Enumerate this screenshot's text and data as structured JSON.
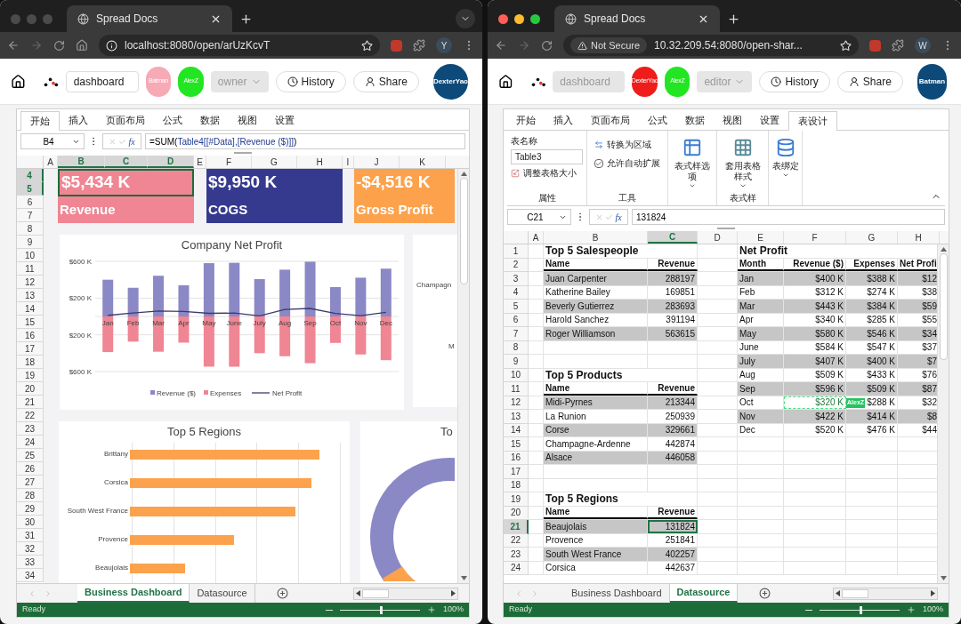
{
  "windows": [
    {
      "traffic_lights_active": false,
      "tab_title": "Spread Docs",
      "tab_search_button": true,
      "home_button": true,
      "address": {
        "not_secure": false,
        "url": "localhost:8080/open/arUzKcvT"
      },
      "profile": "Y",
      "header": {
        "doc_name": {
          "value": "dashboard",
          "disabled": false
        },
        "collaborators": [
          {
            "name": "Batman",
            "color": "#f7a9b6"
          },
          {
            "name": "AlexZ",
            "color": "#22e622"
          }
        ],
        "role": "owner",
        "history": "History",
        "share": "Share",
        "user": "DexterYao"
      },
      "ribbon": {
        "tabs": [
          {
            "label": "开始",
            "selected": true
          },
          {
            "label": "插入",
            "selected": false
          },
          {
            "label": "页面布局",
            "selected": false
          },
          {
            "label": "公式",
            "selected": false
          },
          {
            "label": "数据",
            "selected": false
          },
          {
            "label": "视图",
            "selected": false
          },
          {
            "label": "设置",
            "selected": false
          }
        ]
      },
      "formula_bar": {
        "cell": "B4",
        "fx_label": "fx",
        "formula": [
          {
            "text": "=SUM(",
            "kind": "plain"
          },
          {
            "text": "Table4[[#Data],[Revenue ($)]]",
            "kind": "reference"
          },
          {
            "text": ")",
            "kind": "plain"
          }
        ]
      },
      "columns": [
        {
          "label": "A",
          "selected": false
        },
        {
          "label": "B",
          "selected": true
        },
        {
          "label": "C",
          "selected": true
        },
        {
          "label": "D",
          "selected": true
        },
        {
          "label": "E",
          "selected": false
        },
        {
          "label": "F",
          "selected": false
        },
        {
          "label": "G",
          "selected": false
        },
        {
          "label": "H",
          "selected": false
        },
        {
          "label": "I",
          "selected": false
        },
        {
          "label": "J",
          "selected": false
        },
        {
          "label": "K",
          "selected": false
        }
      ],
      "rows": [
        {
          "label": "4",
          "selected": true
        },
        {
          "label": "5",
          "selected": true
        },
        {
          "label": "6",
          "selected": false
        },
        {
          "label": "7",
          "selected": false
        },
        {
          "label": "8",
          "selected": false
        },
        {
          "label": "9",
          "selected": false
        },
        {
          "label": "10",
          "selected": false
        },
        {
          "label": "11",
          "selected": false
        },
        {
          "label": "12",
          "selected": false
        },
        {
          "label": "13",
          "selected": false
        },
        {
          "label": "14",
          "selected": false
        },
        {
          "label": "15",
          "selected": false
        },
        {
          "label": "16",
          "selected": false
        },
        {
          "label": "17",
          "selected": false
        },
        {
          "label": "18",
          "selected": false
        },
        {
          "label": "19",
          "selected": false
        },
        {
          "label": "20",
          "selected": false
        },
        {
          "label": "21",
          "selected": false
        },
        {
          "label": "22",
          "selected": false
        },
        {
          "label": "23",
          "selected": false
        },
        {
          "label": "24",
          "selected": false
        },
        {
          "label": "25",
          "selected": false
        },
        {
          "label": "26",
          "selected": false
        },
        {
          "label": "27",
          "selected": false
        },
        {
          "label": "28",
          "selected": false
        },
        {
          "label": "29",
          "selected": false
        },
        {
          "label": "30",
          "selected": false
        },
        {
          "label": "31",
          "selected": false
        },
        {
          "label": "32",
          "selected": false
        },
        {
          "label": "33",
          "selected": false
        },
        {
          "label": "34",
          "selected": false
        }
      ],
      "sheet": {
        "kind": "dashboard",
        "kpis": [
          {
            "value": "$5,434 K",
            "label": "Revenue",
            "color": "#f08593",
            "selected": true
          },
          {
            "value": "$9,950 K",
            "label": "COGS",
            "color": "#363a8f",
            "selected": false
          },
          {
            "value": "-$4,516 K",
            "label": "Gross Profit",
            "color": "#fca24c",
            "selected": false
          }
        ],
        "net_profit_chart": {
          "chart_data": {
            "type": "bar",
            "title": "Company Net Profit",
            "stacked": true,
            "legend": true,
            "categories": [
              "Jan",
              "Feb",
              "Mar",
              "Apr",
              "May",
              "June",
              "July",
              "Aug",
              "Sep",
              "Oct",
              "Nov",
              "Dec"
            ],
            "series": [
              {
                "name": "Revenue ($)",
                "type": "bar",
                "color": "#8b88c6",
                "values": [
                  400,
                  312,
                  443,
                  340,
                  580,
                  584,
                  407,
                  509,
                  596,
                  320,
                  422,
                  520
                ]
              },
              {
                "name": "Expenses",
                "type": "bar",
                "color": "#f08593",
                "values": [
                  -388,
                  -274,
                  -384,
                  -285,
                  -546,
                  -547,
                  -400,
                  -433,
                  -509,
                  -288,
                  -414,
                  -476
                ]
              },
              {
                "name": "Net Profit",
                "type": "line",
                "color": "#3b3b6b",
                "values": [
                  12,
                  38,
                  59,
                  55,
                  34,
                  37,
                  7,
                  76,
                  87,
                  32,
                  8,
                  44
                ]
              }
            ],
            "grid": true,
            "ylim": [
              -600,
              600
            ],
            "yticks": [
              {
                "value": 600,
                "label": "$600 K"
              },
              {
                "value": 200,
                "label": "$200 K"
              },
              {
                "value": -200,
                "label": "$200 K"
              },
              {
                "value": -600,
                "label": "$600 K"
              }
            ]
          }
        },
        "side_chart": {
          "labels": [
            "Champagn",
            "M"
          ]
        },
        "regions_chart": {
          "title": "Top 5 Regions",
          "categories": [
            "Brittany",
            "Corsica",
            "South West France",
            "Provence",
            "Beaujolais"
          ]
        },
        "donut_chart": {
          "title": "To"
        }
      },
      "sheet_tabs": [
        {
          "label": "Business Dashboard",
          "selected": true
        },
        {
          "label": "Datasource",
          "selected": false
        }
      ],
      "status_bar": {
        "status": "Ready",
        "zoom": {
          "level": 0.5,
          "reading": "100%"
        }
      }
    },
    {
      "traffic_lights_active": true,
      "tab_title": "Spread Docs",
      "tab_search_button": false,
      "home_button": false,
      "address": {
        "not_secure": true,
        "badge": "Not Secure",
        "url": "10.32.209.54:8080/open-shar..."
      },
      "profile": "W",
      "header": {
        "doc_name": {
          "value": "dashboard",
          "disabled": true
        },
        "collaborators": [
          {
            "name": "DexterYao",
            "color": "#ef1c1c"
          },
          {
            "name": "AlexZ",
            "color": "#22e622"
          }
        ],
        "role": "editor",
        "history": "History",
        "share": "Share",
        "user": "Batman"
      },
      "ribbon": {
        "tabs": [
          {
            "label": "开始",
            "selected": false
          },
          {
            "label": "插入",
            "selected": false
          },
          {
            "label": "页面布局",
            "selected": false
          },
          {
            "label": "公式",
            "selected": false
          },
          {
            "label": "数据",
            "selected": false
          },
          {
            "label": "视图",
            "selected": false
          },
          {
            "label": "设置",
            "selected": false
          },
          {
            "label": "表设计",
            "selected": true
          }
        ],
        "panel": {
          "table_name_label": "表名称",
          "table_name": "Table3",
          "resize": "调整表格大小",
          "properties_group": "属性",
          "convert": "转换为区域",
          "auto_expand": {
            "label": "允许自动扩展",
            "checked": true
          },
          "tools_group": "工具",
          "style_options": "表式样选项",
          "apply_style": "套用表格样式",
          "styles_group": "表式样",
          "binding": "表绑定"
        }
      },
      "formula_bar": {
        "cell": "C21",
        "fx_label": "fx",
        "formula": [
          {
            "text": "131824",
            "kind": "plain"
          }
        ]
      },
      "columns": [
        {
          "label": "A",
          "selected": false
        },
        {
          "label": "B",
          "selected": false
        },
        {
          "label": "C",
          "selected": true
        },
        {
          "label": "D",
          "selected": false
        },
        {
          "label": "E",
          "selected": false
        },
        {
          "label": "F",
          "selected": false
        },
        {
          "label": "G",
          "selected": false
        },
        {
          "label": "H",
          "selected": false
        }
      ],
      "sheet": {
        "kind": "datasource",
        "rows": [
          {
            "label": "1",
            "selected": false,
            "left": {
              "kind": "title",
              "text": "Top 5 Salespeople"
            },
            "right": {
              "kind": "title",
              "text": "Net Profit"
            }
          },
          {
            "label": "2",
            "selected": false,
            "left": {
              "kind": "header",
              "name": "Name",
              "revenue": "Revenue"
            },
            "right": {
              "kind": "header",
              "month": "Month",
              "revenue": "Revenue ($)",
              "expenses": "Expenses",
              "net_profit": "Net Profi"
            }
          },
          {
            "label": "3",
            "selected": false,
            "left": {
              "kind": "band",
              "name": "Juan Carpenter",
              "revenue": "288197"
            },
            "right": {
              "kind": "band",
              "month": "Jan",
              "revenue": "$400 K",
              "expenses": "$388 K",
              "net_profit": "$12"
            }
          },
          {
            "label": "4",
            "selected": false,
            "left": {
              "kind": "plain",
              "name": "Katherine Bailey",
              "revenue": "169851"
            },
            "right": {
              "kind": "plain",
              "month": "Feb",
              "revenue": "$312 K",
              "expenses": "$274 K",
              "net_profit": "$38"
            }
          },
          {
            "label": "5",
            "selected": false,
            "left": {
              "kind": "band",
              "name": "Beverly Gutierrez",
              "revenue": "283693"
            },
            "right": {
              "kind": "band",
              "month": "Mar",
              "revenue": "$443 K",
              "expenses": "$384 K",
              "net_profit": "$59"
            }
          },
          {
            "label": "6",
            "selected": false,
            "left": {
              "kind": "plain",
              "name": "Harold Sanchez",
              "revenue": "391194"
            },
            "right": {
              "kind": "plain",
              "month": "Apr",
              "revenue": "$340 K",
              "expenses": "$285 K",
              "net_profit": "$55"
            }
          },
          {
            "label": "7",
            "selected": false,
            "left": {
              "kind": "band",
              "name": "Roger Williamson",
              "revenue": "563615"
            },
            "right": {
              "kind": "band",
              "month": "May",
              "revenue": "$580 K",
              "expenses": "$546 K",
              "net_profit": "$34"
            }
          },
          {
            "label": "8",
            "selected": false,
            "right": {
              "kind": "plain",
              "month": "June",
              "revenue": "$584 K",
              "expenses": "$547 K",
              "net_profit": "$37"
            }
          },
          {
            "label": "9",
            "selected": false,
            "right": {
              "kind": "band",
              "month": "July",
              "revenue": "$407 K",
              "expenses": "$400 K",
              "net_profit": "$7"
            }
          },
          {
            "label": "10",
            "selected": false,
            "left": {
              "kind": "title",
              "text": "Top 5 Products"
            },
            "right": {
              "kind": "plain",
              "month": "Aug",
              "revenue": "$509 K",
              "expenses": "$433 K",
              "net_profit": "$76"
            }
          },
          {
            "label": "11",
            "selected": false,
            "left": {
              "kind": "header",
              "name": "Name",
              "revenue": "Revenue"
            },
            "right": {
              "kind": "band",
              "month": "Sep",
              "revenue": "$596 K",
              "expenses": "$509 K",
              "net_profit": "$87"
            }
          },
          {
            "label": "12",
            "selected": false,
            "left": {
              "kind": "band",
              "name": "Midi-Pyrnes",
              "revenue": "213344"
            },
            "right": {
              "kind": "plain",
              "month": "Oct",
              "revenue": "$320 K",
              "expenses": "$288 K",
              "net_profit": "$32",
              "collaborator": "AlexZ"
            }
          },
          {
            "label": "13",
            "selected": false,
            "left": {
              "kind": "plain",
              "name": "La Runion",
              "revenue": "250939"
            },
            "right": {
              "kind": "band",
              "month": "Nov",
              "revenue": "$422 K",
              "expenses": "$414 K",
              "net_profit": "$8"
            }
          },
          {
            "label": "14",
            "selected": false,
            "left": {
              "kind": "band",
              "name": "Corse",
              "revenue": "329661"
            },
            "right": {
              "kind": "plain",
              "month": "Dec",
              "revenue": "$520 K",
              "expenses": "$476 K",
              "net_profit": "$44"
            }
          },
          {
            "label": "15",
            "selected": false,
            "left": {
              "kind": "plain",
              "name": "Champagne-Ardenne",
              "revenue": "442874"
            }
          },
          {
            "label": "16",
            "selected": false,
            "left": {
              "kind": "band",
              "name": "Alsace",
              "revenue": "446058"
            }
          },
          {
            "label": "17",
            "selected": false
          },
          {
            "label": "18",
            "selected": false
          },
          {
            "label": "19",
            "selected": false,
            "left": {
              "kind": "title",
              "text": "Top 5 Regions"
            }
          },
          {
            "label": "20",
            "selected": false,
            "left": {
              "kind": "header",
              "name": "Name",
              "revenue": "Revenue"
            }
          },
          {
            "label": "21",
            "selected": true,
            "left": {
              "kind": "band",
              "name": "Beaujolais",
              "revenue": "131824",
              "active": true
            }
          },
          {
            "label": "22",
            "selected": false,
            "left": {
              "kind": "plain",
              "name": "Provence",
              "revenue": "251841"
            }
          },
          {
            "label": "23",
            "selected": false,
            "left": {
              "kind": "band",
              "name": "South West France",
              "revenue": "402257"
            }
          },
          {
            "label": "24",
            "selected": false,
            "left": {
              "kind": "plain",
              "name": "Corsica",
              "revenue": "442637"
            }
          }
        ]
      },
      "sheet_tabs": [
        {
          "label": "Business Dashboard",
          "selected": false
        },
        {
          "label": "Datasource",
          "selected": true
        }
      ],
      "status_bar": {
        "status": "Ready",
        "zoom": {
          "level": 0.5,
          "reading": "100%"
        }
      }
    }
  ]
}
